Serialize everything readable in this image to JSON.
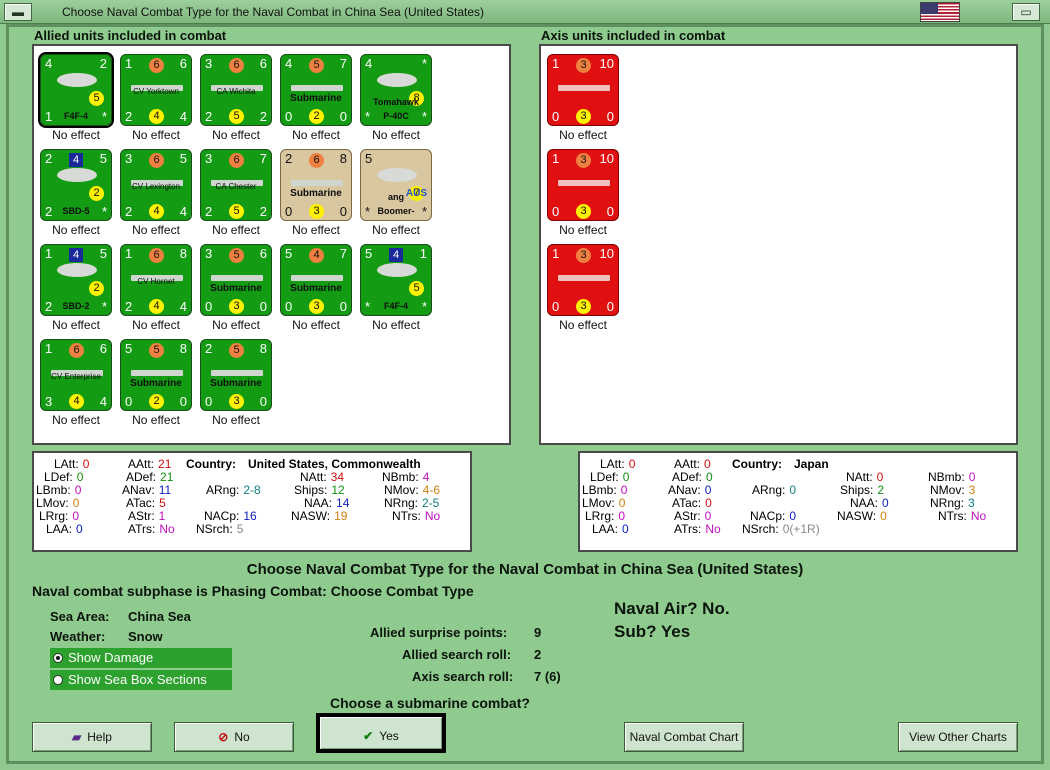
{
  "window": {
    "title": "Choose Naval Combat Type for the Naval Combat in China Sea (United States)"
  },
  "allied": {
    "header": "Allied units included in combat",
    "units": [
      {
        "kind": "plane",
        "tl": "4",
        "tr": "2",
        "bl": "1",
        "br": "*",
        "label": "F4F-4",
        "yellow": "5",
        "effect": "No effect"
      },
      {
        "kind": "ship",
        "tl": "1",
        "orange": "6",
        "tr": "6",
        "bl": "2",
        "br": "4",
        "label": "CV Yorktown",
        "yellow": "4",
        "effect": "No effect"
      },
      {
        "kind": "ship",
        "tl": "3",
        "orange": "6",
        "tr": "6",
        "bl": "2",
        "br": "2",
        "label": "CA Wichita",
        "yellow": "5",
        "effect": "No effect"
      },
      {
        "kind": "ship",
        "tl": "4",
        "orange": "5",
        "tr": "7",
        "bl": "0",
        "br": "0",
        "label": "Submarine",
        "yellow": "2",
        "effect": "No effect"
      },
      {
        "kind": "plane",
        "tl": "4",
        "tr": "*",
        "bl": "*",
        "br": "*",
        "label": "P-40C",
        "label2": "Tomahawk",
        "yellow": "8",
        "effect": "No effect"
      },
      {
        "kind": "plane",
        "tl": "2",
        "tr": "5",
        "bl": "2",
        "br": "*",
        "label": "SBD-5",
        "blue": "4",
        "yellow": "2",
        "effect": "No effect"
      },
      {
        "kind": "ship",
        "tl": "3",
        "orange": "6",
        "tr": "5",
        "bl": "2",
        "br": "4",
        "label": "CV Lexington",
        "yellow": "4",
        "effect": "No effect"
      },
      {
        "kind": "ship",
        "tl": "3",
        "orange": "6",
        "tr": "7",
        "bl": "2",
        "br": "2",
        "label": "CA Chester",
        "yellow": "5",
        "effect": "No effect"
      },
      {
        "kind": "sub-tan",
        "tl": "2",
        "orange": "6",
        "tr": "8",
        "bl": "0",
        "br": "0",
        "label": "Submarine",
        "yellow": "3",
        "effect": "No effect"
      },
      {
        "kind": "plane-tan",
        "tl": "5",
        "tr": "",
        "bl": "*",
        "br": "*",
        "label": "Boomer-",
        "label2": "ang",
        "tag": "AUS",
        "yellow": "7",
        "effect": "No effect"
      },
      {
        "kind": "plane",
        "tl": "1",
        "tr": "5",
        "bl": "2",
        "br": "*",
        "label": "SBD-2",
        "blue": "4",
        "yellow": "2",
        "effect": "No effect"
      },
      {
        "kind": "ship",
        "tl": "1",
        "orange": "6",
        "tr": "8",
        "bl": "2",
        "br": "4",
        "label": "CV Hornet",
        "yellow": "4",
        "effect": "No effect"
      },
      {
        "kind": "ship",
        "tl": "3",
        "orange": "5",
        "tr": "6",
        "bl": "0",
        "br": "0",
        "label": "Submarine",
        "yellow": "3",
        "effect": "No effect"
      },
      {
        "kind": "ship",
        "tl": "5",
        "orange": "4",
        "tr": "7",
        "bl": "0",
        "br": "0",
        "label": "Submarine",
        "yellow": "3",
        "effect": "No effect"
      },
      {
        "kind": "plane",
        "tl": "5",
        "tr": "1",
        "bl": "*",
        "br": "*",
        "label": "F4F-4",
        "blue": "4",
        "yellow": "5",
        "effect": "No effect"
      },
      {
        "kind": "ship",
        "tl": "1",
        "orange": "6",
        "tr": "6",
        "bl": "3",
        "br": "4",
        "label": "CV Enterprise",
        "yellow": "4",
        "effect": "No effect"
      },
      {
        "kind": "ship",
        "tl": "5",
        "orange": "5",
        "tr": "8",
        "bl": "0",
        "br": "0",
        "label": "Submarine",
        "yellow": "2",
        "effect": "No effect"
      },
      {
        "kind": "ship",
        "tl": "2",
        "orange": "5",
        "tr": "8",
        "bl": "0",
        "br": "0",
        "label": "Submarine",
        "yellow": "3",
        "effect": "No effect"
      }
    ],
    "stats": {
      "LAtt": "0",
      "LDef": "0",
      "LBmb": "0",
      "LMov": "0",
      "LRrg": "0",
      "LAA": "0",
      "AAtt": "21",
      "ADef": "21",
      "ANav": "11",
      "ATac": "5",
      "AStr": "1",
      "ATrs": "No",
      "ARng": "2-8",
      "NACp": "16",
      "NSrch": "5",
      "country_label": "Country:",
      "country": "United States, Commonwealth",
      "NAtt": "34",
      "Ships": "12",
      "NAA": "14",
      "NASW": "19",
      "NBmb": "4",
      "NMov": "4-6",
      "NRng": "2-5",
      "NTrs": "No"
    }
  },
  "axis": {
    "header": "Axis units included in combat",
    "units": [
      {
        "kind": "ship-red",
        "tl": "1",
        "orange": "3",
        "tr": "10",
        "bl": "0",
        "br": "0",
        "yellow": "3",
        "effect": "No effect"
      },
      {
        "kind": "ship-red",
        "tl": "1",
        "orange": "3",
        "tr": "10",
        "bl": "0",
        "br": "0",
        "yellow": "3",
        "effect": "No effect"
      },
      {
        "kind": "ship-red",
        "tl": "1",
        "orange": "3",
        "tr": "10",
        "bl": "0",
        "br": "0",
        "yellow": "3",
        "effect": "No effect"
      }
    ],
    "stats": {
      "LAtt": "0",
      "LDef": "0",
      "LBmb": "0",
      "LMov": "0",
      "LRrg": "0",
      "LAA": "0",
      "AAtt": "0",
      "ADef": "0",
      "ANav": "0",
      "ATac": "0",
      "AStr": "0",
      "ATrs": "No",
      "ARng": "0",
      "NACp": "0",
      "NSrch": "0(+1R)",
      "country_label": "Country:",
      "country": "Japan",
      "NAtt": "0",
      "Ships": "2",
      "NAA": "0",
      "NASW": "0",
      "NBmb": "0",
      "NMov": "3",
      "NRng": "3",
      "NTrs": "No"
    }
  },
  "main": {
    "heading": "Choose Naval Combat Type for the Naval Combat in China Sea (United States)",
    "subphase": "Naval combat subphase is Phasing Combat: Choose Combat Type",
    "sea_area_label": "Sea Area:",
    "sea_area": "China Sea",
    "weather_label": "Weather:",
    "weather": "Snow",
    "show_damage": "Show Damage",
    "show_sea_box": "Show Sea Box Sections",
    "surprise_label": "Allied surprise points:",
    "surprise": "9",
    "allied_search_label": "Allied search roll:",
    "allied_search": "2",
    "axis_search_label": "Axis search roll:",
    "axis_search": "7 (6)",
    "naval_air": "Naval Air?  No.",
    "sub": "Sub?  Yes",
    "question": "Choose a submarine combat?"
  },
  "buttons": {
    "help": "Help",
    "no": "No",
    "yes": "Yes",
    "naval_chart": "Naval Combat Chart",
    "other_charts": "View Other Charts"
  }
}
